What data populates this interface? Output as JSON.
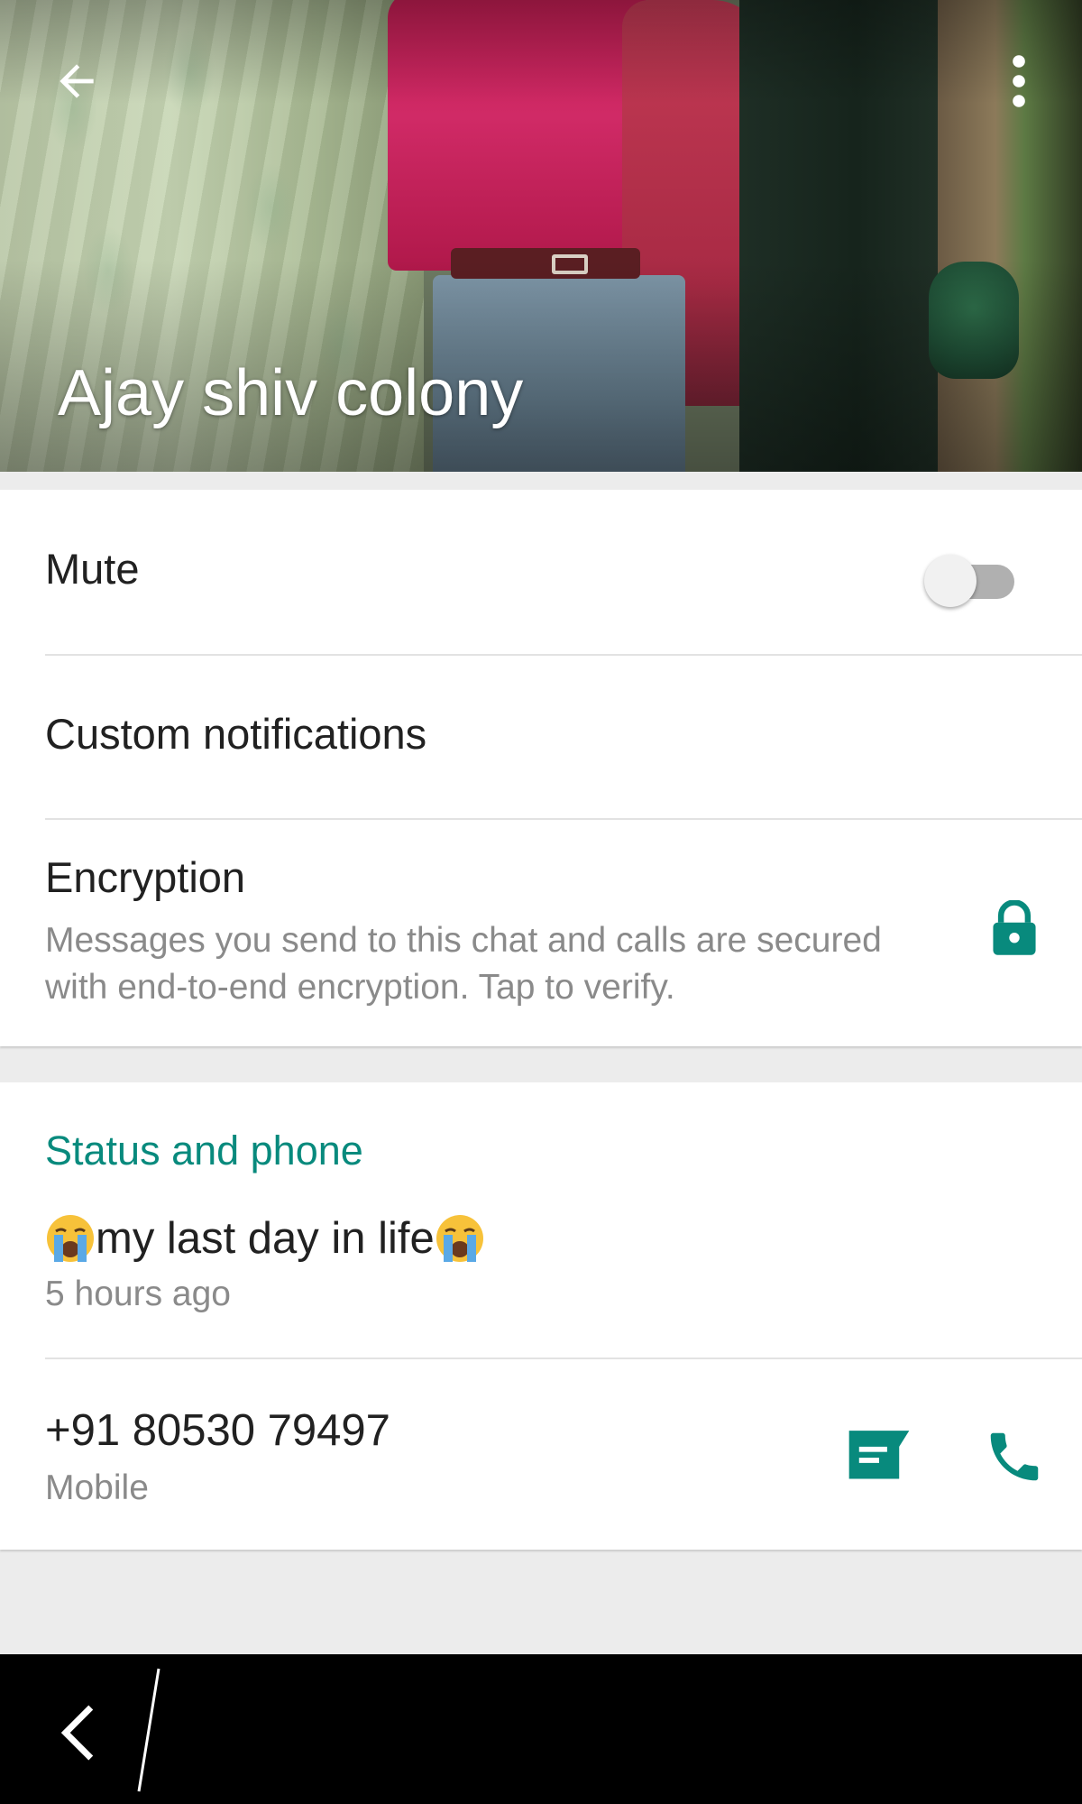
{
  "header": {
    "contact_name": "Ajay shiv colony",
    "back_icon": "arrow-left-icon",
    "menu_icon": "more-vert-icon"
  },
  "settings": {
    "mute_label": "Mute",
    "mute_enabled": false,
    "custom_notifications_label": "Custom notifications",
    "encryption_label": "Encryption",
    "encryption_description": "Messages you send to this chat and calls are secured with end-to-end encryption. Tap to verify.",
    "encryption_icon": "lock-icon"
  },
  "status_phone": {
    "section_title": "Status and phone",
    "status_text": "my last day in life",
    "status_emoji": "loudly-crying-face-emoji",
    "status_time": "5 hours ago",
    "phone_number": "+91 80530 79497",
    "phone_type": "Mobile",
    "message_icon": "message-icon",
    "call_icon": "phone-icon"
  },
  "colors": {
    "accent": "#088a7d",
    "primary_text": "#212121",
    "secondary_text": "#8a8a8a",
    "background": "#ececec"
  },
  "navbar": {
    "back_icon": "chevron-left-icon"
  }
}
